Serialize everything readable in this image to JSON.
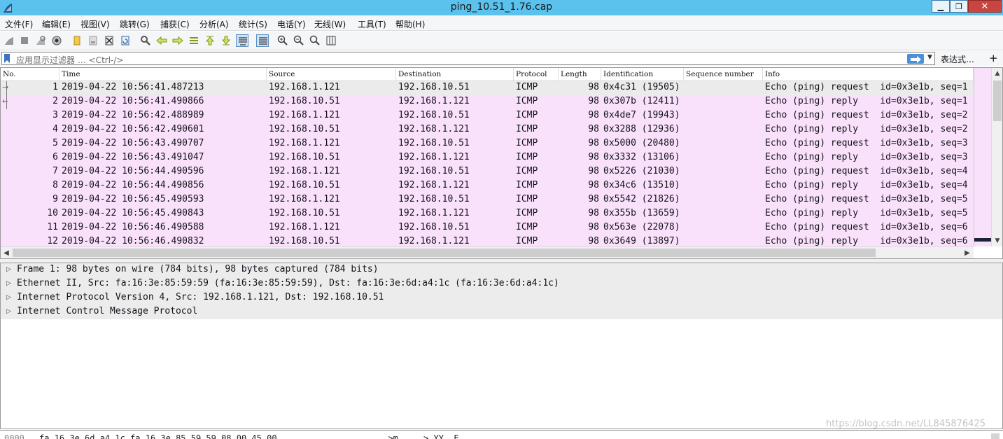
{
  "window": {
    "title": "ping_10.51_1.76.cap",
    "min_glyph": "▁",
    "max_glyph": "❐",
    "close_glyph": "✕"
  },
  "menu": [
    "文件(F)",
    "编辑(E)",
    "视图(V)",
    "跳转(G)",
    "捕获(C)",
    "分析(A)",
    "统计(S)",
    "电话(Y)",
    "无线(W)",
    "工具(T)",
    "帮助(H)"
  ],
  "filter": {
    "placeholder": "应用显示过滤器 … <Ctrl-/>",
    "expression_label": "表达式…",
    "add_label": "+"
  },
  "columns": [
    "No.",
    "Time",
    "Source",
    "Destination",
    "Protocol",
    "Length",
    "Identification",
    "Sequence number",
    "Info"
  ],
  "packets": [
    {
      "no": "1",
      "time": "2019-04-22 10:56:41.487213",
      "src": "192.168.1.121",
      "dst": "192.168.10.51",
      "proto": "ICMP",
      "len": "98",
      "id": "0x4c31 (19505)",
      "info": "Echo (ping) request  id=0x3e1b, seq=1"
    },
    {
      "no": "2",
      "time": "2019-04-22 10:56:41.490866",
      "src": "192.168.10.51",
      "dst": "192.168.1.121",
      "proto": "ICMP",
      "len": "98",
      "id": "0x307b (12411)",
      "info": "Echo (ping) reply    id=0x3e1b, seq=1"
    },
    {
      "no": "3",
      "time": "2019-04-22 10:56:42.488989",
      "src": "192.168.1.121",
      "dst": "192.168.10.51",
      "proto": "ICMP",
      "len": "98",
      "id": "0x4de7 (19943)",
      "info": "Echo (ping) request  id=0x3e1b, seq=2"
    },
    {
      "no": "4",
      "time": "2019-04-22 10:56:42.490601",
      "src": "192.168.10.51",
      "dst": "192.168.1.121",
      "proto": "ICMP",
      "len": "98",
      "id": "0x3288 (12936)",
      "info": "Echo (ping) reply    id=0x3e1b, seq=2"
    },
    {
      "no": "5",
      "time": "2019-04-22 10:56:43.490707",
      "src": "192.168.1.121",
      "dst": "192.168.10.51",
      "proto": "ICMP",
      "len": "98",
      "id": "0x5000 (20480)",
      "info": "Echo (ping) request  id=0x3e1b, seq=3"
    },
    {
      "no": "6",
      "time": "2019-04-22 10:56:43.491047",
      "src": "192.168.10.51",
      "dst": "192.168.1.121",
      "proto": "ICMP",
      "len": "98",
      "id": "0x3332 (13106)",
      "info": "Echo (ping) reply    id=0x3e1b, seq=3"
    },
    {
      "no": "7",
      "time": "2019-04-22 10:56:44.490596",
      "src": "192.168.1.121",
      "dst": "192.168.10.51",
      "proto": "ICMP",
      "len": "98",
      "id": "0x5226 (21030)",
      "info": "Echo (ping) request  id=0x3e1b, seq=4"
    },
    {
      "no": "8",
      "time": "2019-04-22 10:56:44.490856",
      "src": "192.168.10.51",
      "dst": "192.168.1.121",
      "proto": "ICMP",
      "len": "98",
      "id": "0x34c6 (13510)",
      "info": "Echo (ping) reply    id=0x3e1b, seq=4"
    },
    {
      "no": "9",
      "time": "2019-04-22 10:56:45.490593",
      "src": "192.168.1.121",
      "dst": "192.168.10.51",
      "proto": "ICMP",
      "len": "98",
      "id": "0x5542 (21826)",
      "info": "Echo (ping) request  id=0x3e1b, seq=5"
    },
    {
      "no": "10",
      "time": "2019-04-22 10:56:45.490843",
      "src": "192.168.10.51",
      "dst": "192.168.1.121",
      "proto": "ICMP",
      "len": "98",
      "id": "0x355b (13659)",
      "info": "Echo (ping) reply    id=0x3e1b, seq=5"
    },
    {
      "no": "11",
      "time": "2019-04-22 10:56:46.490588",
      "src": "192.168.1.121",
      "dst": "192.168.10.51",
      "proto": "ICMP",
      "len": "98",
      "id": "0x563e (22078)",
      "info": "Echo (ping) request  id=0x3e1b, seq=6"
    },
    {
      "no": "12",
      "time": "2019-04-22 10:56:46.490832",
      "src": "192.168.10.51",
      "dst": "192.168.1.121",
      "proto": "ICMP",
      "len": "98",
      "id": "0x3649 (13897)",
      "info": "Echo (ping) reply    id=0x3e1b, seq=6"
    }
  ],
  "details": [
    "Frame 1: 98 bytes on wire (784 bits), 98 bytes captured (784 bits)",
    "Ethernet II, Src: fa:16:3e:85:59:59 (fa:16:3e:85:59:59), Dst: fa:16:3e:6d:a4:1c (fa:16:3e:6d:a4:1c)",
    "Internet Protocol Version 4, Src: 192.168.1.121, Dst: 192.168.10.51",
    "Internet Control Message Protocol"
  ],
  "bytes_row": {
    "offset": "0000",
    "hex": "fa 16 3e 6d a4 1c fa 16  3e 85 59 59 08 00 45 00",
    "ascii": "..>m.... >.YY..E."
  },
  "watermark": "https://blog.csdn.net/LL845876425",
  "colors": {
    "titlebar": "#5bc2ee",
    "icmp_row": "#fae1fb",
    "selected_row": "#ebebeb",
    "close_button": "#c9453f"
  },
  "toolbar_icons": [
    "shark-fin-start-icon",
    "stop-icon",
    "restart-icon",
    "capture-options-icon",
    "open-file-icon",
    "save-file-icon",
    "close-file-icon",
    "reload-icon",
    "find-packet-icon",
    "go-back-icon",
    "go-forward-icon",
    "go-to-packet-icon",
    "first-packet-icon",
    "last-packet-icon",
    "auto-scroll-icon",
    "colorize-icon",
    "zoom-in-icon",
    "zoom-out-icon",
    "normal-size-icon",
    "resize-columns-icon"
  ]
}
